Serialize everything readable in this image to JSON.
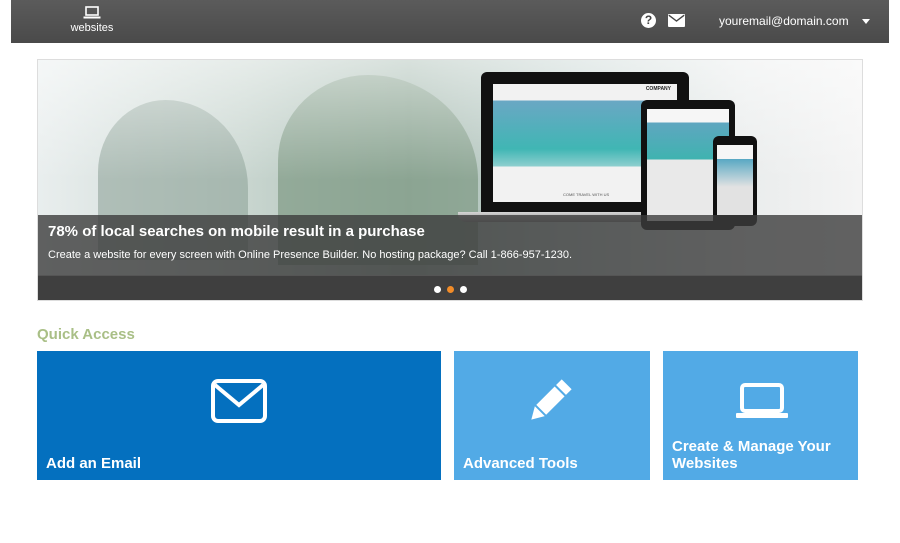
{
  "topbar": {
    "nav_websites_label": "websites",
    "help_icon": "question-circle-icon",
    "mail_icon": "envelope-icon",
    "user_email": "youremail@domain.com"
  },
  "banner": {
    "headline": "78% of local searches on mobile result in a purchase",
    "subtext": "Create a website for every screen with Online Presence Builder. No hosting package? Call 1-866-957-1230.",
    "device_screen_brand": "COMPANY",
    "device_screen_tagline": "COME TRAVEL WITH US",
    "slide_count": 3,
    "active_slide": 2
  },
  "quick_access": {
    "title": "Quick Access",
    "tiles": [
      {
        "label": "Add an Email",
        "icon": "envelope-icon",
        "color": "#0470bf"
      },
      {
        "label": "Advanced Tools",
        "icon": "pencil-icon",
        "color": "#52aae6"
      },
      {
        "label": "Create & Manage Your Websites",
        "icon": "laptop-icon",
        "color": "#52aae6"
      }
    ]
  },
  "colors": {
    "topbar_bg": "#4a4a4a",
    "accent_title": "#a9bf86",
    "dot_active": "#f28c28",
    "dot_inactive": "#ffffff"
  }
}
